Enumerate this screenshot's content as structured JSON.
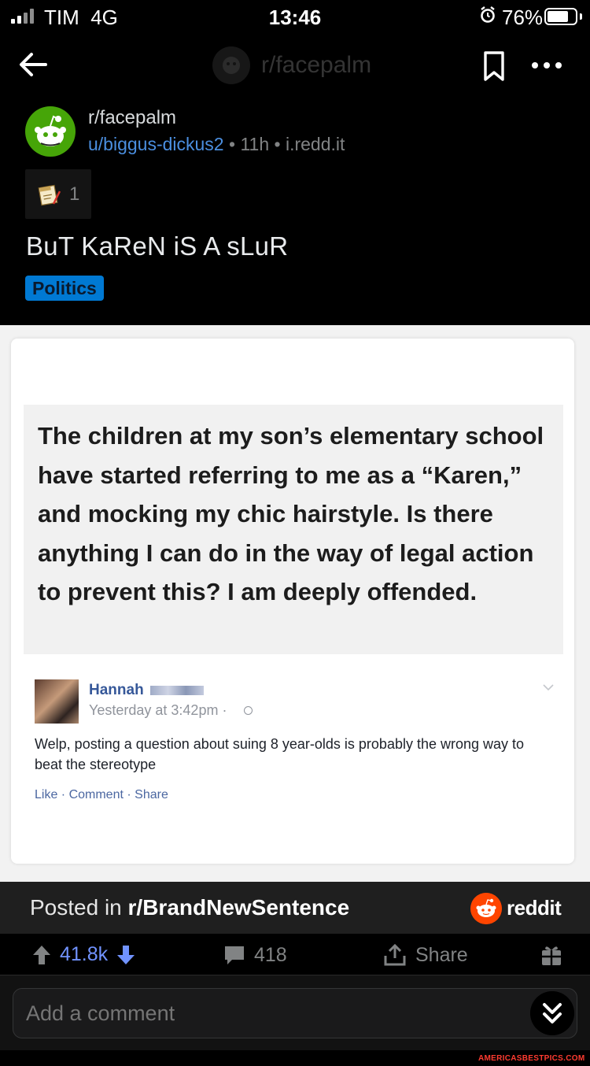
{
  "status_bar": {
    "carrier": "TIM",
    "network": "4G",
    "time": "13:46",
    "battery": "76%"
  },
  "nav": {
    "title": "r/facepalm"
  },
  "post": {
    "subreddit": "r/facepalm",
    "author": "u/biggus-dickus2",
    "age": "11h",
    "domain": "i.redd.it",
    "separator": "•",
    "award_count": "1",
    "title": "BuT KaReN iS A sLuR",
    "flair": "Politics",
    "flair_color": "#0079d3"
  },
  "image": {
    "quote": "The children at my son’s elementary school have started referring to me as a “Karen,” and mocking my chic hairstyle. Is there anything I can do in the way of legal action to prevent this? I am deeply offended.",
    "reply_name": "Hannah",
    "reply_time": "Yesterday at 3:42pm ·",
    "reply_text": "Welp, posting a question about suing 8 year-olds is probably the wrong way to beat the stereotype",
    "reply_actions": "Like · Comment · Share"
  },
  "crosspost": {
    "prefix": "Posted in ",
    "subreddit": "r/BrandNewSentence",
    "brand": "reddit"
  },
  "actions": {
    "votes": "41.8k",
    "comments": "418",
    "share": "Share",
    "upvote_color": "#7193ff"
  },
  "composer": {
    "placeholder": "Add a comment"
  },
  "watermark": "AMERICASBESTPICS.COM"
}
